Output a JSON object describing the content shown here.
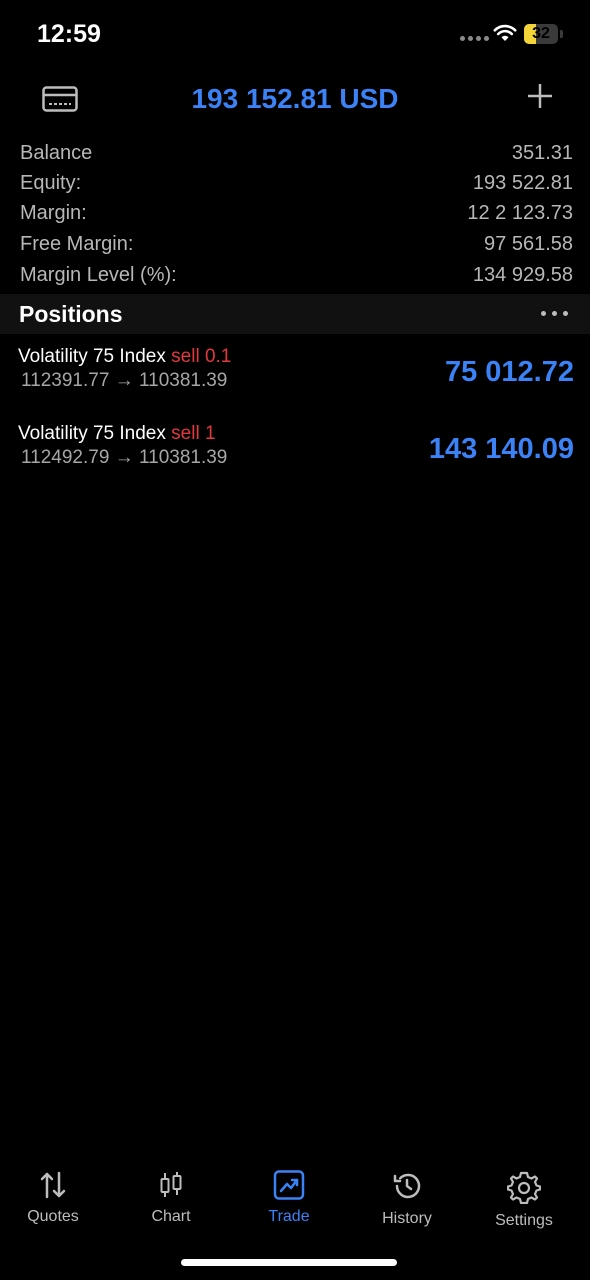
{
  "status_bar": {
    "time": "12:59",
    "battery": "32"
  },
  "header": {
    "title": "193 152.81 USD",
    "left_icon": "card-icon",
    "right_icon": "plus-icon"
  },
  "account": [
    {
      "label": "Balance",
      "value": "351.31"
    },
    {
      "label": "Equity:",
      "value": "193 522.81"
    },
    {
      "label": "Margin:",
      "value": "12 2 123.73"
    },
    {
      "label": "Free Margin:",
      "value": "97 561.58"
    },
    {
      "label": "Margin Level (%):",
      "value": "134 929.58"
    }
  ],
  "positions": {
    "title": "Positions",
    "items": [
      {
        "symbol": "Volatility 75 Index",
        "type": "sell 0.1",
        "open": "112391.77",
        "arrow": "→",
        "current": "110381.39",
        "profit": "75 012.72"
      },
      {
        "symbol": "Volatility 75 Index",
        "type": "sell  1",
        "open": "112492.79",
        "arrow": "→",
        "current": "110381.39",
        "profit": "143 140.09"
      }
    ]
  },
  "tabs": [
    {
      "label": "Quotes",
      "icon": "quotes-icon"
    },
    {
      "label": "Chart",
      "icon": "chart-icon"
    },
    {
      "label": "Trade",
      "icon": "trade-icon",
      "active": true
    },
    {
      "label": "History",
      "icon": "history-icon"
    },
    {
      "label": "Settings",
      "icon": "settings-icon"
    }
  ],
  "colors": {
    "accent": "#3b82f6",
    "sell": "#e0393e",
    "background": "#000000",
    "battery": "#f3d53a"
  }
}
